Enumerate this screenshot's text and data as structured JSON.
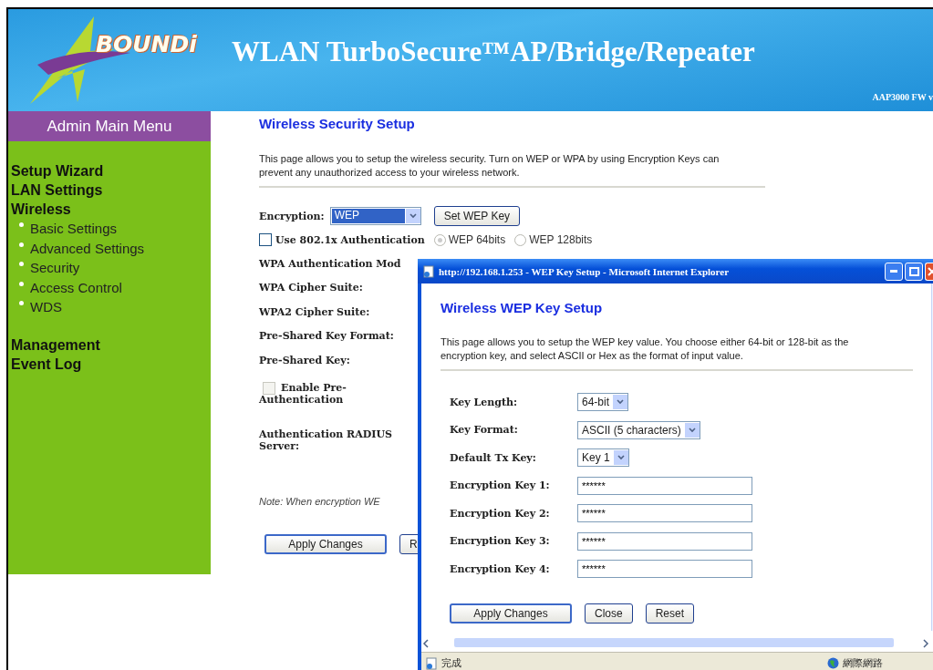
{
  "header": {
    "logo": "BOUNDi",
    "title": "WLAN TurboSecure™AP/Bridge/Repeater",
    "model": "AAP3000 FW v"
  },
  "sidebar": {
    "title": "Admin Main Menu",
    "items": [
      {
        "label": "Setup Wizard"
      },
      {
        "label": "LAN Settings"
      },
      {
        "label": "Wireless",
        "children": [
          {
            "label": "Basic Settings"
          },
          {
            "label": "Advanced Settings"
          },
          {
            "label": "Security"
          },
          {
            "label": "Access Control"
          },
          {
            "label": "WDS"
          }
        ]
      },
      {
        "label": "Management"
      },
      {
        "label": "Event Log"
      }
    ]
  },
  "main": {
    "title": "Wireless Security Setup",
    "description": "This page allows you to setup the wireless security. Turn on WEP or WPA by using Encryption Keys can prevent any unauthorized access to your wireless network.",
    "encryption": {
      "label": "Encryption:",
      "value": "WEP",
      "button": "Set WEP Key"
    },
    "dot1x": {
      "label": "Use 802.1x Authentication",
      "checked": false
    },
    "wep_bits": [
      {
        "label": "WEP 64bits",
        "selected": true
      },
      {
        "label": "WEP 128bits",
        "selected": false
      }
    ],
    "labels": [
      "WPA Authentication Mod",
      "WPA Cipher Suite:",
      "WPA2 Cipher Suite:",
      "Pre-Shared Key Format:",
      "Pre-Shared Key:"
    ],
    "pre_auth": {
      "label": "Enable Pre-Authentication",
      "checked": false,
      "disabled": true
    },
    "radius_label": "Authentication RADIUS Server:",
    "note": "Note: When encryption WE",
    "buttons": [
      "Apply Changes",
      "R"
    ]
  },
  "popup": {
    "title": "http://192.168.1.253 - WEP Key Setup - Microsoft Internet Explorer",
    "heading": "Wireless WEP Key Setup",
    "description": "This page allows you to setup the WEP key value. You choose either 64-bit or 128-bit as the encryption key, and select ASCII or Hex as the format of input value.",
    "selects": [
      {
        "label": "Key Length:",
        "value": "64-bit"
      },
      {
        "label": "Key Format:",
        "value": "ASCII (5 characters)"
      },
      {
        "label": "Default Tx Key:",
        "value": "Key 1"
      }
    ],
    "keys": [
      {
        "label": "Encryption Key 1:",
        "value": "******"
      },
      {
        "label": "Encryption Key 2:",
        "value": "******"
      },
      {
        "label": "Encryption Key 3:",
        "value": "******"
      },
      {
        "label": "Encryption Key 4:",
        "value": "******"
      }
    ],
    "buttons": [
      "Apply Changes",
      "Close",
      "Reset"
    ],
    "status": {
      "text": "完成",
      "zone": "網際網路"
    }
  }
}
